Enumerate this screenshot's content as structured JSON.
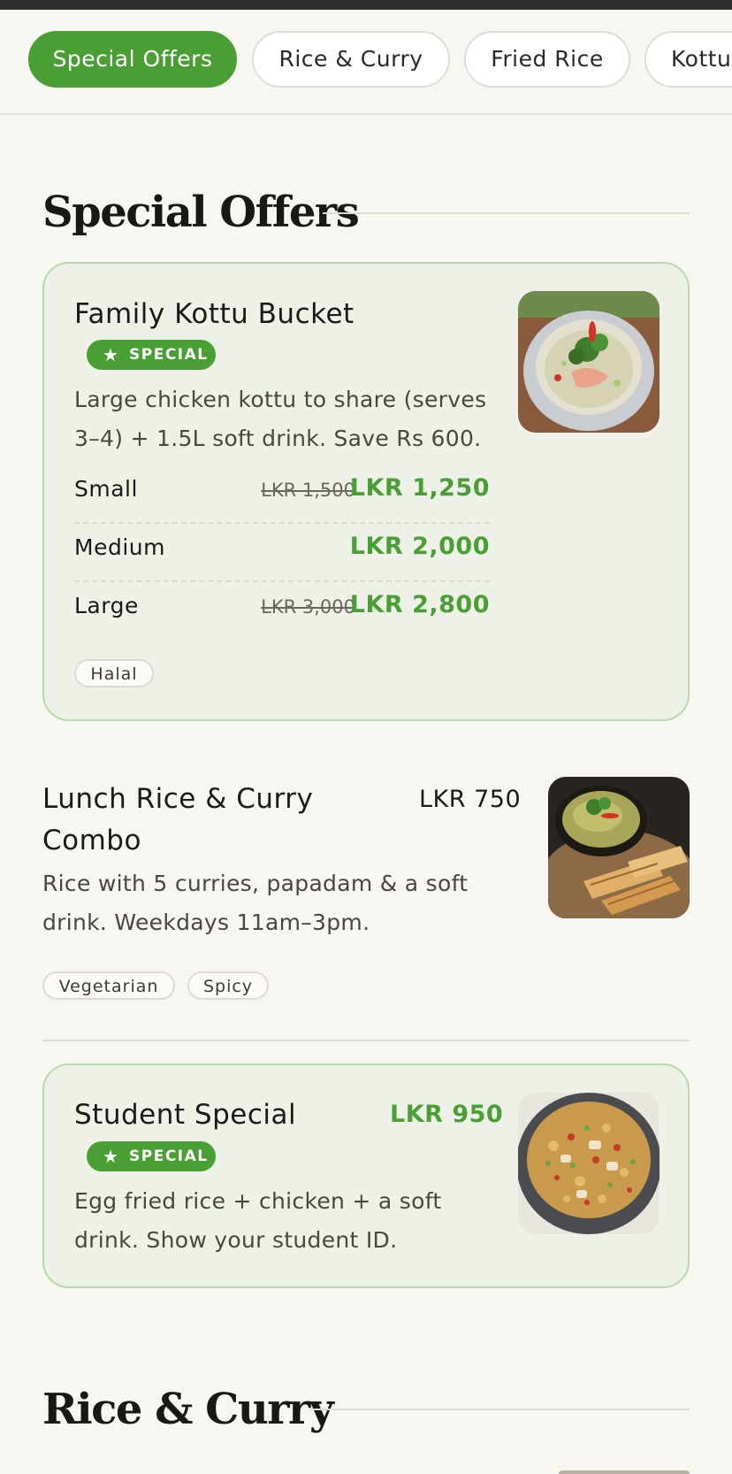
{
  "nav": {
    "tabs": [
      {
        "label": "Special Offers",
        "active": true
      },
      {
        "label": "Rice & Curry",
        "active": false
      },
      {
        "label": "Fried Rice",
        "active": false
      },
      {
        "label": "Kottu",
        "active": false
      }
    ]
  },
  "sections": [
    {
      "title": "Special Offers",
      "items": [
        {
          "name": "Family Kottu Bucket",
          "badge": "SPECIAL",
          "description": "Large chicken kottu to share (serves 3–4) + 1.5L soft drink. Save Rs 600.",
          "sizes": [
            {
              "label": "Small",
              "old_price": "LKR 1,500",
              "price": "LKR 1,250"
            },
            {
              "label": "Medium",
              "old_price": "",
              "price": "LKR 2,000"
            },
            {
              "label": "Large",
              "old_price": "LKR 3,000",
              "price": "LKR 2,800"
            }
          ],
          "tags": [
            "Halal"
          ],
          "photo": "noodle-soup-bowl"
        },
        {
          "name": "Lunch Rice & Curry Combo",
          "price": "LKR 750",
          "description": "Rice with 5 curries, papadam & a soft drink. Weekdays 11am–3pm.",
          "tags": [
            "Vegetarian",
            "Spicy"
          ],
          "photo": "green-curry-with-roti"
        },
        {
          "name": "Student Special",
          "badge": "SPECIAL",
          "price": "LKR 950",
          "description": "Egg fried rice + chicken + a soft drink. Show your student ID.",
          "photo": "fried-rice-bowl"
        }
      ]
    },
    {
      "title": "Rice & Curry"
    }
  ],
  "colors": {
    "accent": "#4a9f34",
    "card_bg": "#eef1e7",
    "card_border": "#b5dba6",
    "page_bg": "#f8f6f1"
  }
}
